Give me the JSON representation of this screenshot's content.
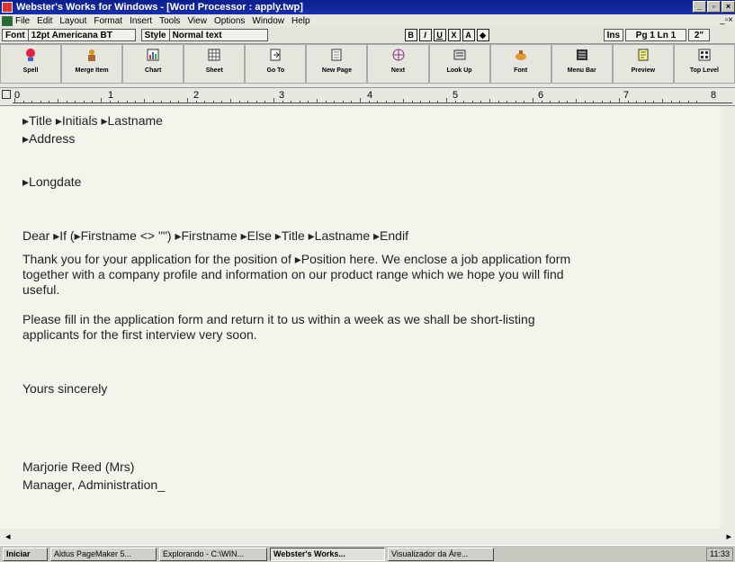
{
  "title": "Webster's Works for Windows - [Word Processor : apply.twp]",
  "menu": [
    "File",
    "Edit",
    "Layout",
    "Format",
    "Insert",
    "Tools",
    "View",
    "Options",
    "Window",
    "Help"
  ],
  "format": {
    "font_label": "Font",
    "font_value": "12pt Americana BT",
    "style_label": "Style",
    "style_value": "Normal text",
    "buttons": [
      "B",
      "I",
      "U",
      "X",
      "A",
      "◆"
    ],
    "mode": "Ins",
    "position": "Pg 1 Ln 1",
    "indent": "2\""
  },
  "toolbar": [
    "Spell",
    "Merge Item",
    "Chart",
    "Sheet",
    "Go To",
    "New Page",
    "Next",
    "Look Up",
    "Font",
    "Menu Bar",
    "Preview",
    "Top Level"
  ],
  "ruler": [
    "0",
    "1",
    "2",
    "3",
    "4",
    "5",
    "6",
    "7",
    "8"
  ],
  "document": {
    "line1": "▸Title ▸Initials ▸Lastname",
    "line2": "▸Address",
    "longdate": "▸Longdate",
    "salutation": "Dear ▸If (▸Firstname <> \"\") ▸Firstname ▸Else ▸Title ▸Lastname ▸Endif",
    "para1": "Thank you for your application for the position of ▸Position here.  We enclose a job application form together with a company profile and information on our product range which we hope you will find useful.",
    "para2": "Please fill in the application form and return it to us within a week as we shall be short-listing applicants for the first interview very soon.",
    "closing": "Yours sincerely",
    "signer": "Marjorie Reed (Mrs)",
    "signer_title": "Manager, Administration_"
  },
  "taskbar": {
    "start": "Iniciar",
    "tasks": [
      "Aldus PageMaker 5...",
      "Explorando - C:\\WIN...",
      "Webster's Works...",
      "Visualizador da Áre..."
    ],
    "clock": "11:33"
  }
}
